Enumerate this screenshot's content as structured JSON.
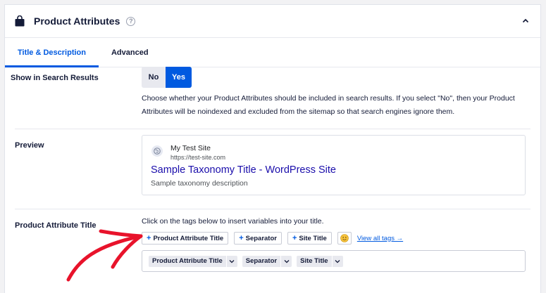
{
  "panel": {
    "title": "Product Attributes",
    "help_glyph": "?"
  },
  "tabs": [
    {
      "label": "Title & Description",
      "active": true
    },
    {
      "label": "Advanced",
      "active": false
    }
  ],
  "search_results": {
    "label": "Show in Search Results",
    "options": [
      "No",
      "Yes"
    ],
    "selected": "Yes",
    "description": "Choose whether your Product Attributes should be included in search results. If you select \"No\", then your Product Attributes will be noindexed and excluded from the sitemap so that search engines ignore them."
  },
  "preview": {
    "label": "Preview",
    "site_name": "My Test Site",
    "site_url": "https://test-site.com",
    "title": "Sample Taxonomy Title - WordPress Site",
    "description": "Sample taxonomy description"
  },
  "attribute_title": {
    "label": "Product Attribute Title",
    "helper": "Click on the tags below to insert variables into your title.",
    "tag_buttons": [
      "Product Attribute Title",
      "Separator",
      "Site Title"
    ],
    "view_all": "View all tags →",
    "chips": [
      "Product Attribute Title",
      "Separator",
      "Site Title"
    ]
  },
  "colors": {
    "accent": "#005ae0",
    "link": "#1a0dab",
    "annotation": "#e8132b"
  },
  "icons": {
    "header": "shopping-bag-icon",
    "help": "question-circle-icon",
    "collapse": "chevron-up-icon",
    "preview": "globe-icon",
    "emoji": "emoji-icon",
    "chip_caret": "chevron-down-icon"
  }
}
